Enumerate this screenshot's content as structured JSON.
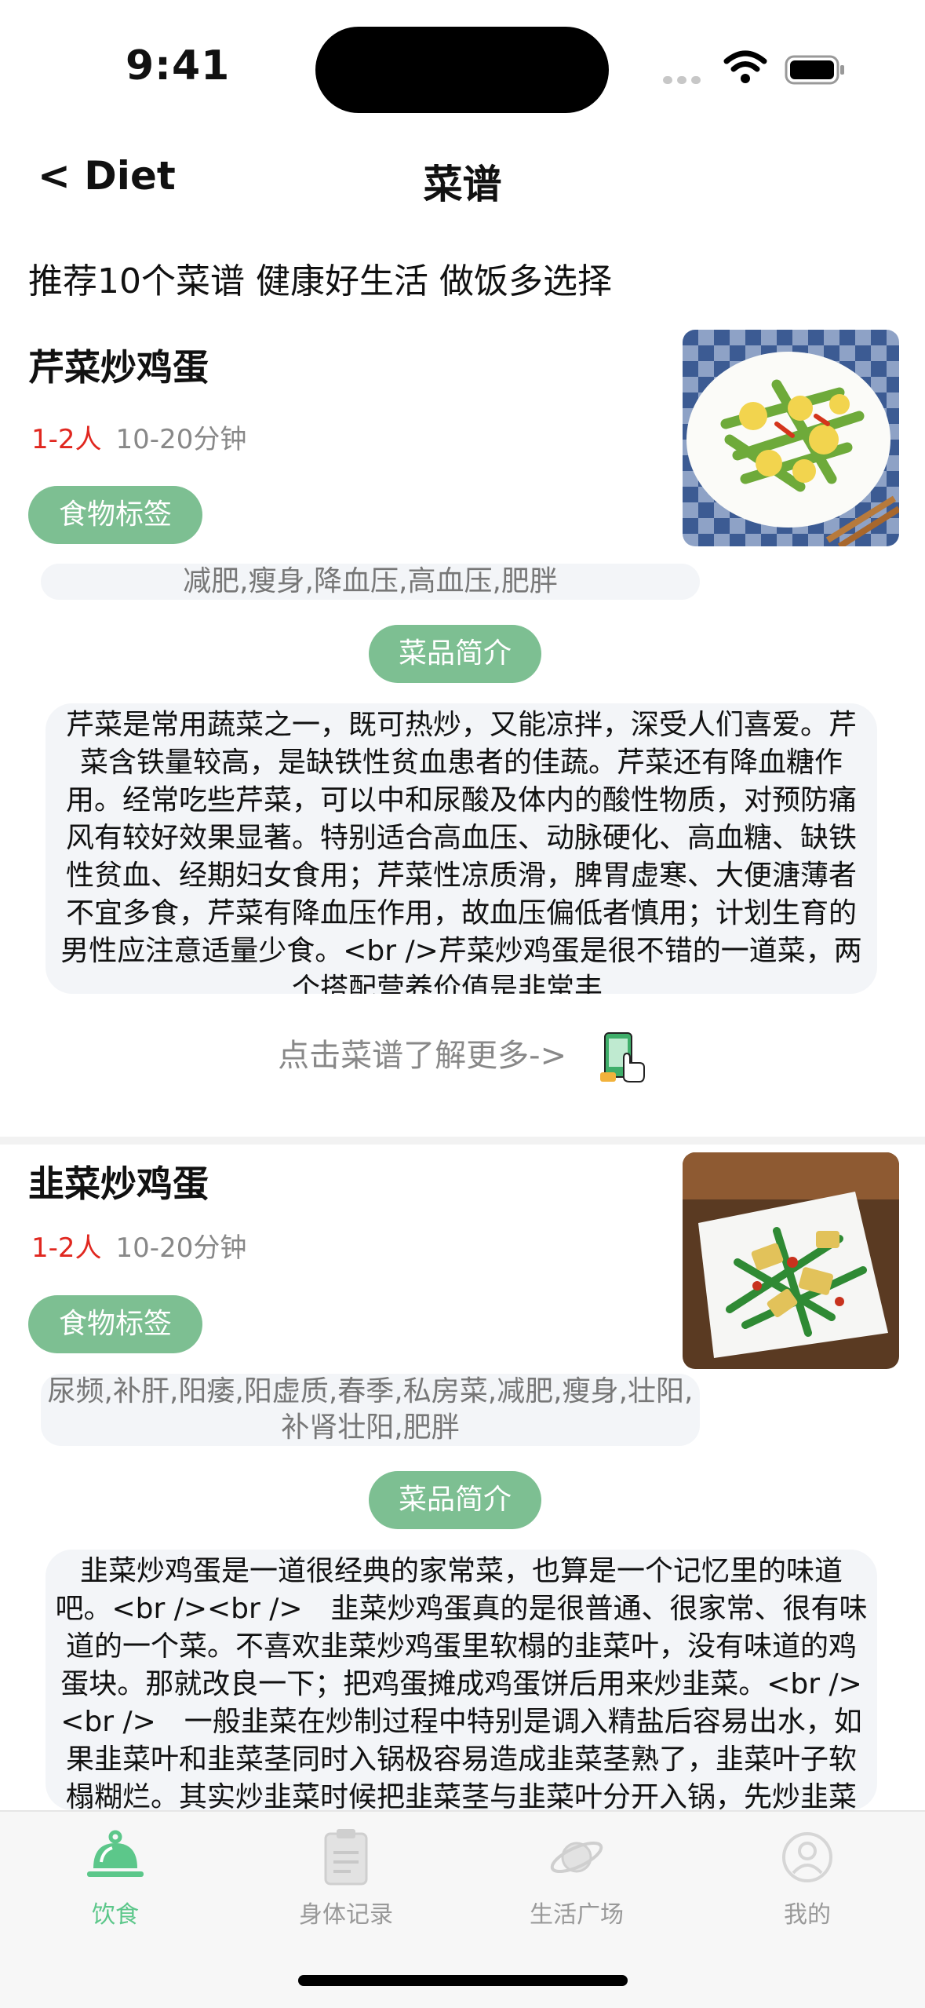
{
  "status": {
    "time": "9:41"
  },
  "nav": {
    "back": "< Diet",
    "title": "菜谱"
  },
  "intro": "推荐10个菜谱  健康好生活 做饭多选择",
  "recipes": [
    {
      "title": "芹菜炒鸡蛋",
      "people": "1-2人",
      "time": "10-20分钟",
      "tag_label": "食物标签",
      "tags": "减肥,瘦身,降血压,高血压,肥胖",
      "intro_label": "菜品简介",
      "description": "芹菜是常用蔬菜之一，既可热炒，又能凉拌，深受人们喜爱。芹菜含铁量较高，是缺铁性贫血患者的佳蔬。芹菜还有降血糖作用。经常吃些芹菜，可以中和尿酸及体内的酸性物质，对预防痛风有较好效果显著。特别适合高血压、动脉硬化、高血糖、缺铁性贫血、经期妇女食用；芹菜性凉质滑，脾胃虚寒、大便溏薄者不宜多食，芹菜有降血压作用，故血压偏低者慎用；计划生育的男性应注意适量少食。<br />芹菜炒鸡蛋是很不错的一道菜，两个搭配营养价值是非常丰…",
      "more": "点击菜谱了解更多->"
    },
    {
      "title": "韭菜炒鸡蛋",
      "people": "1-2人",
      "time": "10-20分钟",
      "tag_label": "食物标签",
      "tags": "尿频,补肝,阳痿,阳虚质,春季,私房菜,减肥,瘦身,壮阳,补肾壮阳,肥胖",
      "intro_label": "菜品简介",
      "description": "韭菜炒鸡蛋是一道很经典的家常菜，也算是一个记忆里的味道吧。<br /><br />　韭菜炒鸡蛋真的是很普通、很家常、很有味道的一个菜。不喜欢韭菜炒鸡蛋里软榻的韭菜叶，没有味道的鸡蛋块。那就改良一下；把鸡蛋摊成鸡蛋饼后用来炒韭菜。<br /><br />　一般韭菜在炒制过程中特别是调入精盐后容易出水，如果韭菜叶和韭菜茎同时入锅极容易造成韭菜茎熟了，韭菜叶子软榻糊烂。其实炒韭菜时候把韭菜茎与韭菜叶分开入锅，先炒韭菜茎稍微翻炒后再放入韭菜叶，这"
    }
  ],
  "tabs": [
    {
      "label": "饮食",
      "icon": "cloche-icon",
      "active": true
    },
    {
      "label": "身体记录",
      "icon": "clipboard-icon",
      "active": false
    },
    {
      "label": "生活广场",
      "icon": "planet-icon",
      "active": false
    },
    {
      "label": "我的",
      "icon": "user-icon",
      "active": false
    }
  ],
  "colors": {
    "accent": "#7dbf92",
    "active_tab": "#5cc78a",
    "people": "#e0271f"
  }
}
